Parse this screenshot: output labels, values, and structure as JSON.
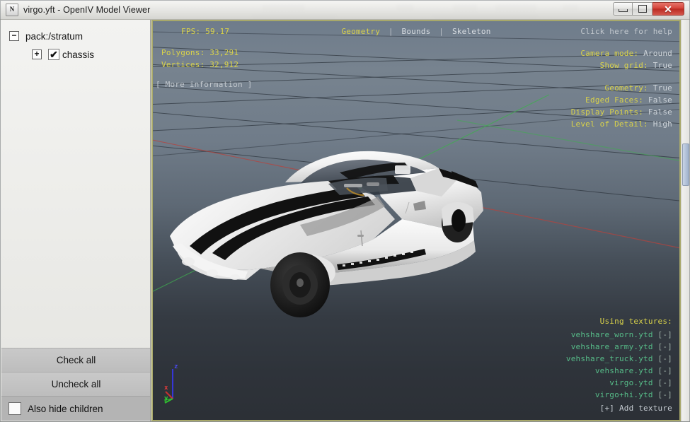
{
  "window": {
    "title": "virgo.yft - OpenIV Model Viewer",
    "icon": "app-icon",
    "minimize_label": "Minimize",
    "maximize_label": "Maximize",
    "close_label": "✕"
  },
  "sidebar": {
    "tree": [
      {
        "label": "pack:/stratum",
        "expander": "−",
        "expanded": true,
        "has_checkbox": false,
        "depth": 0
      },
      {
        "label": "chassis",
        "expander": "+",
        "expanded": false,
        "has_checkbox": true,
        "checked": true,
        "check_glyph": "✔",
        "depth": 1
      }
    ],
    "buttons": {
      "check_all": "Check all",
      "uncheck_all": "Uncheck all"
    },
    "hide_children": {
      "label": "Also hide children",
      "checked": false
    }
  },
  "viewport": {
    "stats": {
      "fps_label": "FPS:",
      "fps_value": "59.17",
      "polygons_label": "Polygons:",
      "polygons_value": "33,291",
      "vertices_label": "Vertices:",
      "vertices_value": "32,912",
      "more_info": "[ More information ]"
    },
    "tabs": [
      {
        "label": "Geometry",
        "active": true
      },
      {
        "label": "Bounds",
        "active": false
      },
      {
        "label": "Skeleton",
        "active": false
      }
    ],
    "tab_separator": "|",
    "help_link": "Click here for help",
    "settings": [
      {
        "key": "Camera mode:",
        "value": "Around"
      },
      {
        "key": "Show grid:",
        "value": "True"
      }
    ],
    "render_settings": [
      {
        "key": "Geometry:",
        "value": "True"
      },
      {
        "key": "Edged Faces:",
        "value": "False"
      },
      {
        "key": "Display Points:",
        "value": "False"
      },
      {
        "key": "Level of Detail:",
        "value": "High"
      }
    ],
    "textures": {
      "title": "Using textures:",
      "items": [
        {
          "name": "vehshare_worn.ytd",
          "tag": "[-]"
        },
        {
          "name": "vehshare_army.ytd",
          "tag": "[-]"
        },
        {
          "name": "vehshare_truck.ytd",
          "tag": "[-]"
        },
        {
          "name": "vehshare.ytd",
          "tag": "[-]"
        },
        {
          "name": "virgo.ytd",
          "tag": "[-]"
        },
        {
          "name": "virgo+hi.ytd",
          "tag": "[-]"
        }
      ],
      "add_label": "[+] Add texture"
    },
    "gizmo": {
      "x_label": "x",
      "y_label": "y",
      "z_label": "z",
      "x_color": "#cc3030",
      "y_color": "#2fbf2f",
      "z_color": "#3030cc"
    },
    "model": "white-shelby-mustang-with-black-racing-stripes"
  },
  "colors": {
    "accent_yellow": "#d9d24a",
    "texture_green": "#57bd89",
    "viewport_border": "#a8a86a",
    "close_button": "#c8392e"
  }
}
